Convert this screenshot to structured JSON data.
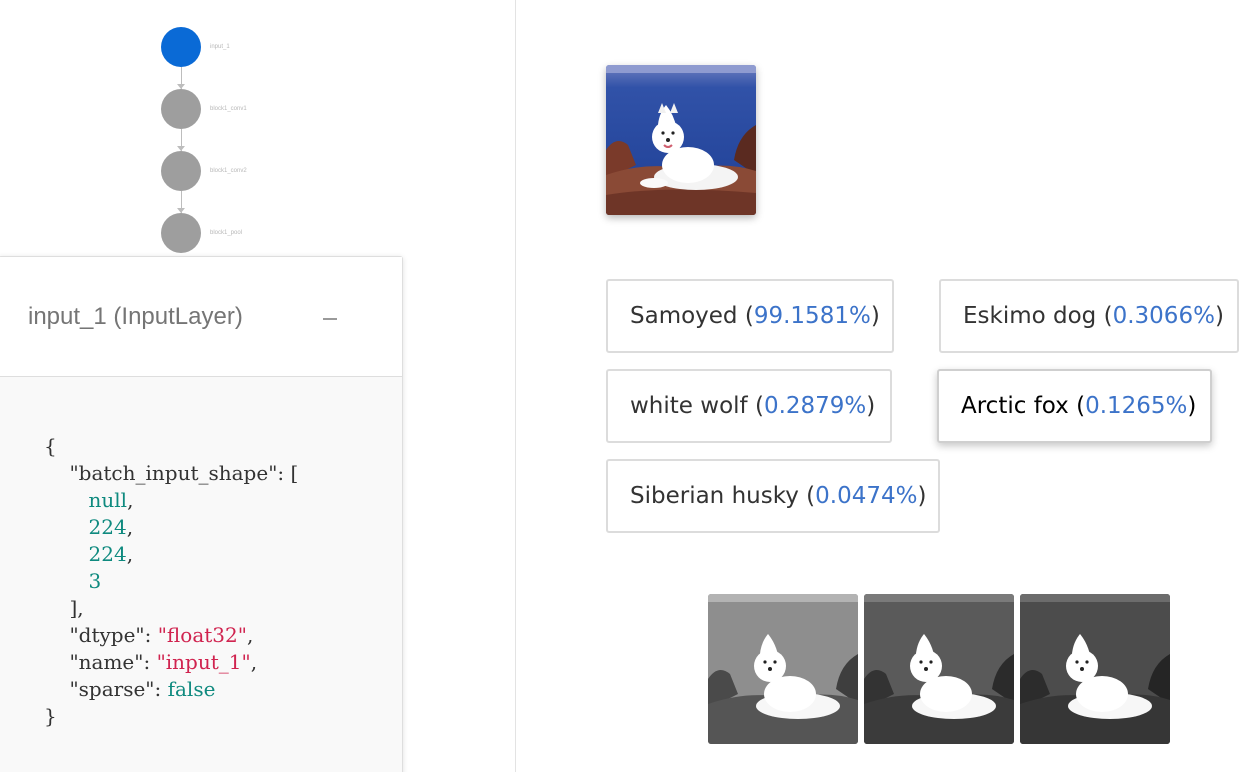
{
  "graph": {
    "nodes": [
      {
        "label": "input_1"
      },
      {
        "label": "block1_conv1"
      },
      {
        "label": "block1_conv2"
      },
      {
        "label": "block1_pool"
      }
    ]
  },
  "layer_panel": {
    "title": "input_1 (InputLayer)",
    "collapse_icon": "minus-icon",
    "config": {
      "open_brace": "{",
      "batch_input_shape_key": "\"batch_input_shape\"",
      "batch_input_shape_open": ": [",
      "shape_values": [
        "null",
        "224",
        "224",
        "3"
      ],
      "shape_close": "],",
      "dtype_key": "\"dtype\"",
      "dtype_value": "\"float32\"",
      "name_key": "\"name\"",
      "name_value": "\"input_1\"",
      "sparse_key": "\"sparse\"",
      "sparse_value": "false",
      "close_brace": "}"
    }
  },
  "predictions": [
    {
      "label": "Samoyed",
      "probability": "99.1581%"
    },
    {
      "label": "Eskimo dog",
      "probability": "0.3066%"
    },
    {
      "label": "white wolf",
      "probability": "0.2879%"
    },
    {
      "label": "Arctic fox",
      "probability": "0.1265%"
    },
    {
      "label": "Siberian husky",
      "probability": "0.0474%"
    }
  ],
  "colors": {
    "active_node": "#0a6ad6",
    "node": "#9e9e9e",
    "probability_text": "#3c73c9",
    "json_number": "#0f8a7f",
    "json_string": "#d0234f"
  }
}
